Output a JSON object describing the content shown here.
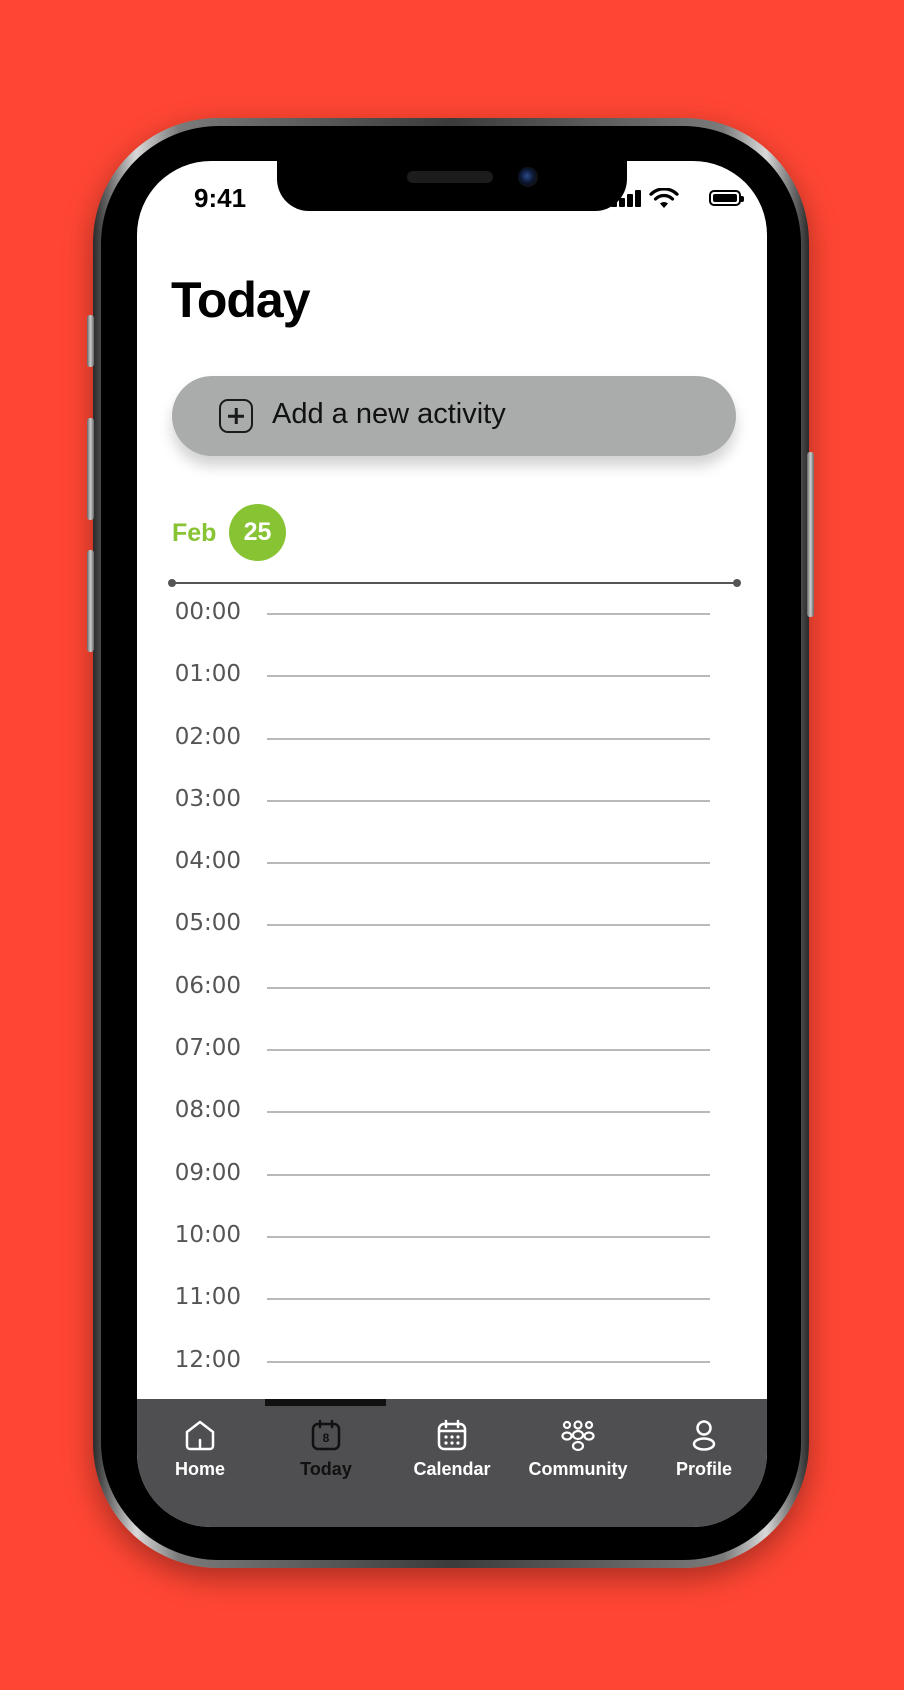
{
  "status_bar": {
    "time": "9:41"
  },
  "header": {
    "title": "Today"
  },
  "add_activity": {
    "label": "Add a new activity",
    "icon": "plus-square-icon"
  },
  "date": {
    "month": "Feb",
    "day": "25",
    "accent_color": "#87c332"
  },
  "timeline": {
    "hours": [
      "00:00",
      "01:00",
      "02:00",
      "03:00",
      "04:00",
      "05:00",
      "06:00",
      "07:00",
      "08:00",
      "09:00",
      "10:00",
      "11:00",
      "12:00"
    ]
  },
  "tabbar": {
    "active_tab": "Today",
    "tabs": [
      {
        "label": "Home",
        "icon": "home-icon"
      },
      {
        "label": "Today",
        "icon": "calendar-day-icon",
        "icon_text": "8"
      },
      {
        "label": "Calendar",
        "icon": "calendar-icon"
      },
      {
        "label": "Community",
        "icon": "community-icon"
      },
      {
        "label": "Profile",
        "icon": "profile-icon"
      }
    ]
  },
  "colors": {
    "background": "#ff4633",
    "tabbar": "#4f4e50",
    "button": "#a9acaa"
  }
}
